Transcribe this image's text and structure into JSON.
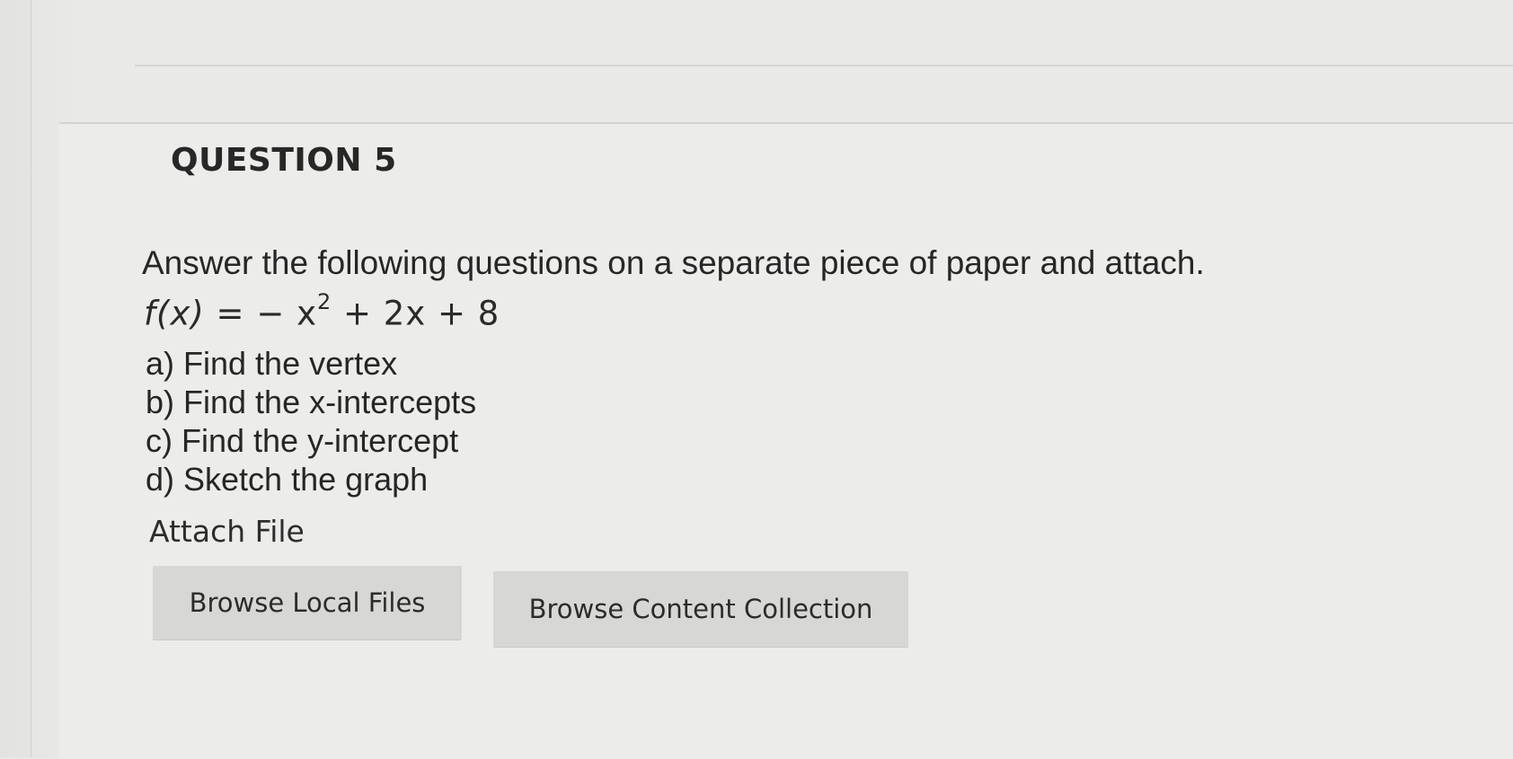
{
  "question": {
    "title": "QUESTION 5",
    "instruction": "Answer the following questions on a separate piece of paper and attach.",
    "formula": {
      "lhs": "f(x)",
      "before_exponent": " = − x",
      "exponent": "2",
      "after_exponent": " + 2x + 8"
    },
    "parts": [
      "a) Find the vertex",
      "b) Find the x-intercepts",
      "c) Find the y-intercept",
      "d) Sketch the graph"
    ]
  },
  "attach": {
    "label": "Attach File",
    "browse_local_label": "Browse Local Files",
    "browse_content_label": "Browse Content Collection"
  }
}
